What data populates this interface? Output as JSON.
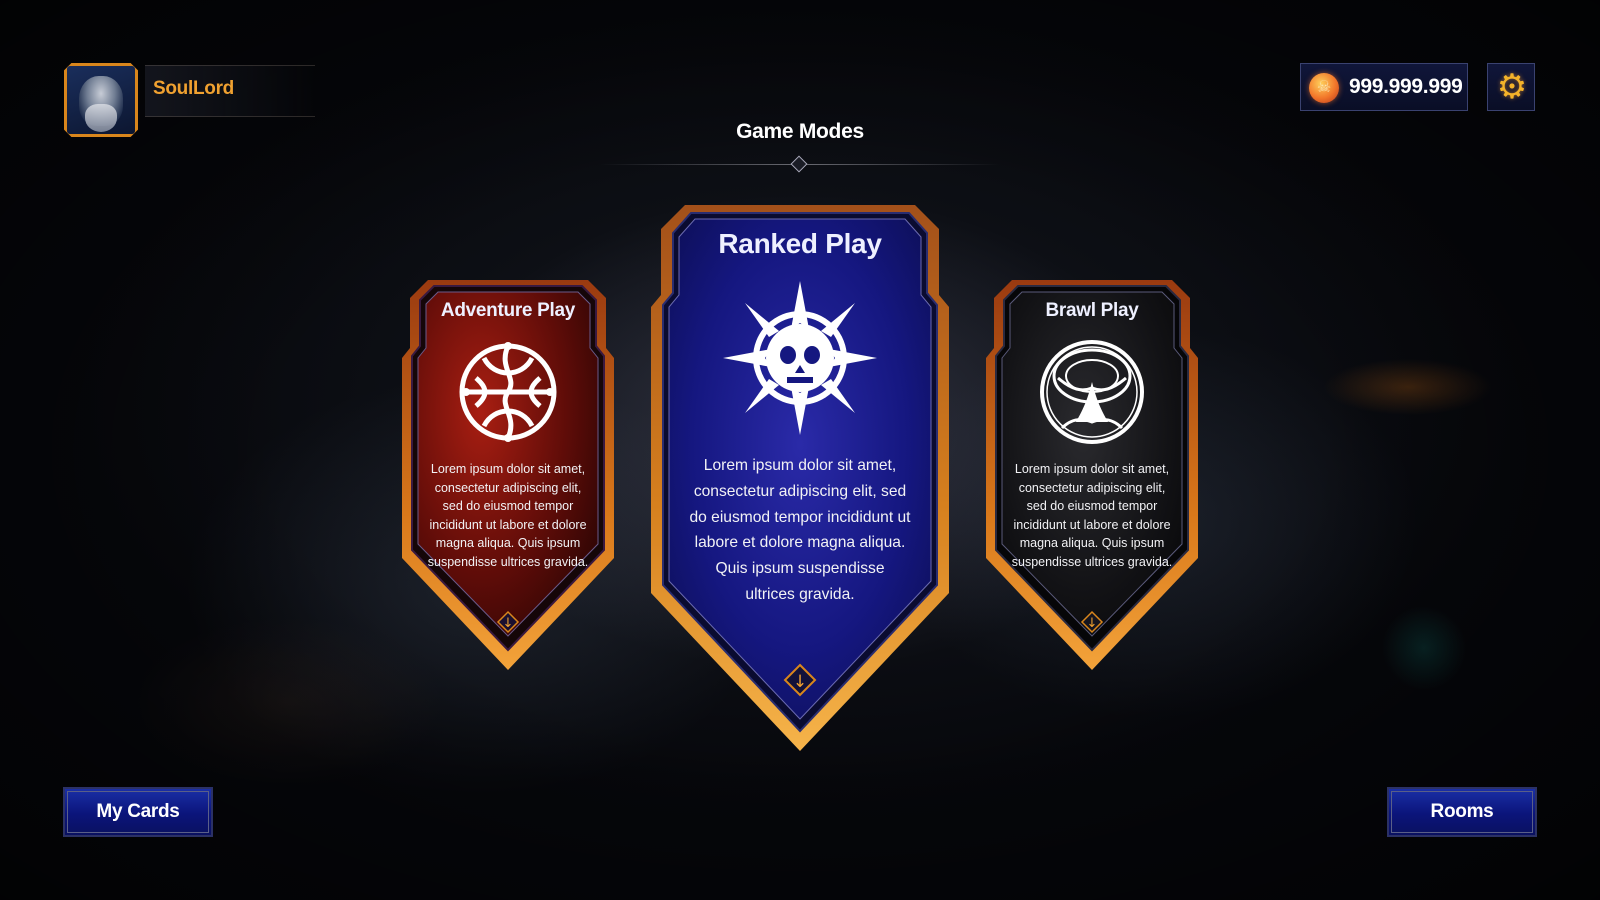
{
  "player": {
    "name": "SoulLord",
    "avatar_icon": "bearded-warrior-portrait"
  },
  "currency": {
    "amount": "999.999.999",
    "icon": "skull-coin-icon"
  },
  "settings": {
    "icon": "gear-icon"
  },
  "title": "Game Modes",
  "modes": [
    {
      "id": "adventure",
      "title": "Adventure Play",
      "icon": "celtic-knot-emblem-icon",
      "description": "Lorem ipsum dolor sit amet, consectetur adipiscing elit, sed do eiusmod tempor incididunt ut labore et dolore magna aliqua. Quis ipsum suspendisse ultrices gravida.",
      "color": "#7a1208"
    },
    {
      "id": "ranked",
      "title": "Ranked Play",
      "icon": "skull-compass-emblem-icon",
      "description": "Lorem ipsum dolor sit amet, consectetur adipiscing elit, sed do eiusmod tempor incididunt ut labore et dolore magna aliqua. Quis ipsum suspendisse ultrices gravida.",
      "color": "#12166e"
    },
    {
      "id": "brawl",
      "title": "Brawl Play",
      "icon": "tree-of-life-emblem-icon",
      "description": "Lorem ipsum dolor sit amet, consectetur adipiscing elit, sed do eiusmod tempor incididunt ut labore et dolore magna aliqua. Quis ipsum suspendisse ultrices gravida.",
      "color": "#0b0b0d"
    }
  ],
  "buttons": {
    "my_cards": "My Cards",
    "rooms": "Rooms"
  },
  "colors": {
    "accent_orange": "#f0a130",
    "frame_gold": "#e8921c",
    "button_blue": "#1a2fa6"
  }
}
